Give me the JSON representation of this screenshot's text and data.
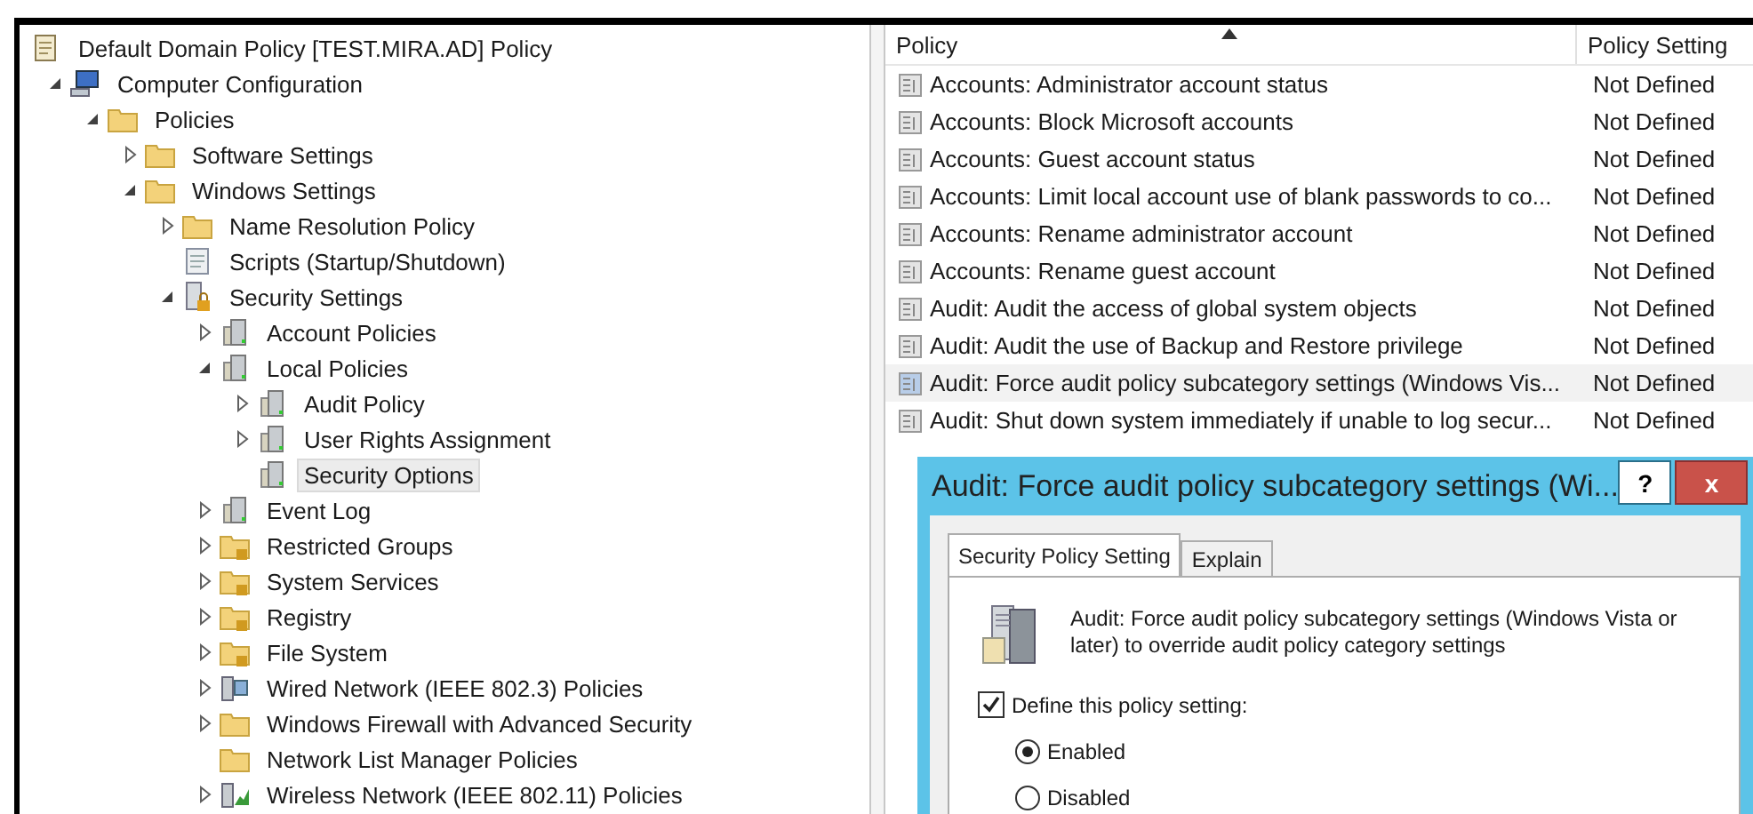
{
  "tree": [
    {
      "label": "Default Domain Policy [TEST.MIRA.AD] Policy",
      "kind": "document",
      "selected": false,
      "children": [
        {
          "label": "Computer Configuration",
          "kind": "computer",
          "selected": false,
          "expanded": true,
          "children": [
            {
              "label": "Policies",
              "kind": "folder",
              "selected": false,
              "expanded": true,
              "children": [
                {
                  "label": "Software Settings",
                  "kind": "folder",
                  "selected": false,
                  "expanded": false
                },
                {
                  "label": "Windows Settings",
                  "kind": "folder",
                  "selected": false,
                  "expanded": true,
                  "children": [
                    {
                      "label": "Name Resolution Policy",
                      "kind": "folder",
                      "selected": false,
                      "expanded": false
                    },
                    {
                      "label": "Scripts (Startup/Shutdown)",
                      "kind": "script",
                      "selected": false
                    },
                    {
                      "label": "Security Settings",
                      "kind": "security",
                      "selected": false,
                      "expanded": true,
                      "children": [
                        {
                          "label": "Account Policies",
                          "kind": "server",
                          "selected": false,
                          "expanded": false
                        },
                        {
                          "label": "Local Policies",
                          "kind": "server",
                          "selected": false,
                          "expanded": true,
                          "children": [
                            {
                              "label": "Audit Policy",
                              "kind": "server",
                              "selected": false,
                              "expanded": false
                            },
                            {
                              "label": "User Rights Assignment",
                              "kind": "server",
                              "selected": false,
                              "expanded": false
                            },
                            {
                              "label": "Security Options",
                              "kind": "server",
                              "selected": true
                            }
                          ]
                        },
                        {
                          "label": "Event Log",
                          "kind": "server",
                          "selected": false,
                          "expanded": false
                        },
                        {
                          "label": "Restricted Groups",
                          "kind": "lock-folder",
                          "selected": false,
                          "expanded": false
                        },
                        {
                          "label": "System Services",
                          "kind": "lock-folder",
                          "selected": false,
                          "expanded": false
                        },
                        {
                          "label": "Registry",
                          "kind": "lock-folder",
                          "selected": false,
                          "expanded": false
                        },
                        {
                          "label": "File System",
                          "kind": "lock-folder",
                          "selected": false,
                          "expanded": false
                        },
                        {
                          "label": "Wired Network (IEEE 802.3) Policies",
                          "kind": "network",
                          "selected": false,
                          "expanded": false
                        },
                        {
                          "label": "Windows Firewall with Advanced Security",
                          "kind": "folder",
                          "selected": false,
                          "expanded": false
                        },
                        {
                          "label": "Network List Manager Policies",
                          "kind": "folder",
                          "selected": false
                        },
                        {
                          "label": "Wireless Network (IEEE 802.11) Policies",
                          "kind": "wireless",
                          "selected": false,
                          "expanded": false
                        }
                      ]
                    }
                  ]
                }
              ]
            }
          ]
        }
      ]
    }
  ],
  "table": {
    "columns": [
      "Policy",
      "Policy Setting"
    ],
    "rows": [
      {
        "policy": "Accounts: Administrator account status",
        "setting": "Not Defined",
        "selected": false
      },
      {
        "policy": "Accounts: Block Microsoft accounts",
        "setting": "Not Defined",
        "selected": false
      },
      {
        "policy": "Accounts: Guest account status",
        "setting": "Not Defined",
        "selected": false
      },
      {
        "policy": "Accounts: Limit local account use of blank passwords to co...",
        "setting": "Not Defined",
        "selected": false
      },
      {
        "policy": "Accounts: Rename administrator account",
        "setting": "Not Defined",
        "selected": false
      },
      {
        "policy": "Accounts: Rename guest account",
        "setting": "Not Defined",
        "selected": false
      },
      {
        "policy": "Audit: Audit the access of global system objects",
        "setting": "Not Defined",
        "selected": false
      },
      {
        "policy": "Audit: Audit the use of Backup and Restore privilege",
        "setting": "Not Defined",
        "selected": false
      },
      {
        "policy": "Audit: Force audit policy subcategory settings (Windows Vis...",
        "setting": "Not Defined",
        "selected": true
      },
      {
        "policy": "Audit: Shut down system immediately if unable to log secur...",
        "setting": "Not Defined",
        "selected": false
      }
    ]
  },
  "dialog": {
    "title": "Audit: Force audit policy subcategory settings (Wi...",
    "help": "?",
    "close": "x",
    "tabs": [
      {
        "label": "Security Policy Setting",
        "selected": true
      },
      {
        "label": "Explain",
        "selected": false
      }
    ],
    "description": "Audit: Force audit policy subcategory settings (Windows Vista or later) to override audit policy category settings",
    "define": {
      "label": "Define this policy setting:",
      "checked": true
    },
    "options": [
      {
        "label": "Enabled",
        "selected": true
      },
      {
        "label": "Disabled",
        "selected": false
      }
    ]
  }
}
